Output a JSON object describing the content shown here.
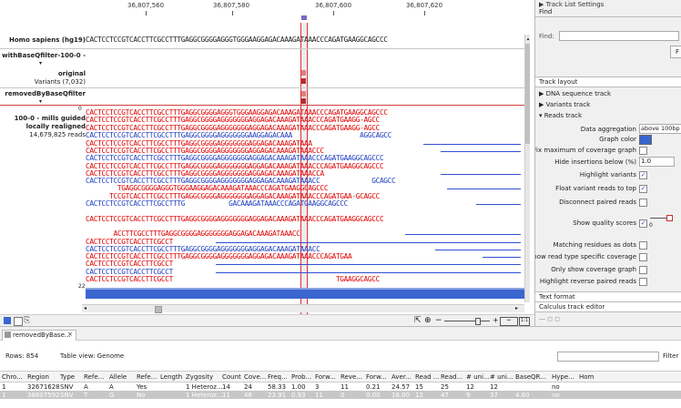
{
  "ruler": [
    "36,807,560",
    "36,807,580",
    "36,807,600",
    "36,807,620"
  ],
  "tracks": {
    "reference": "Homo sapiens (hg19)",
    "withbq": "withBaseQfilter-100-0 -",
    "original_title": "original",
    "original_sub": "Variants (7,032)",
    "removed": "removedByBaseQfilter",
    "mills_1": "100-0 - mills guided",
    "mills_2": "locally realigned",
    "mills_3": "14,679,825 reads",
    "axis_zero": "0",
    "axis_22": "22"
  },
  "reference_seq": "CACTCCTCCGTCACCTTCGCCTTTGAGGCGGGGAGGGTGGGAAGGAGACAAAGATAAACCCAGATGAAGGCAGCCC",
  "consensus_seq": "CACTCCTCCGTCACCTTCGCCTTTGAGGCGGGGAGGGGGGGAGGAGACAAAGATAAACCCAGATGAAGG-AGCC",
  "reads": [
    "CACTCCTCCGTCACCTTCGCCTTTGAGGCGGGGAGGGGGGGAGGAGACAAAGATAAACCCAGATGAAGG-AGCC",
    "CACTCCTCCGTCACCTTCGCCTTTGAGGCGGGGAGGGGGGGAAGGAGACAAA                 AGGCAGCC",
    "CACTCCTCCGTCACCTTCGCCTTTGAGGCGGGGAGGGGGGGAGGAGACAAAGATAAA",
    "CACTCCTCCGTCACCTTCGCCTTTGAGGCGGGGAGGGGGGGAGGAGACAAAGATAAACCC",
    "CACTCCTCCGTCACCTTCGCCTTTGAGGCGGGGAGGGGGGGAGGAGACAAAGATAAACCCAGATGAAGGCAGCCC",
    "CACTCCTCCGTCACCTTCGCCTTTGAGGCGGGGAGGGGGGGAGGAGACAAAGATAAACCCAGATGAAGGCAGCCC",
    "CACTCCTCCGTCACCTTCGCCTTTGAGGCGGGGAGGGGGGGAGGAGACAAAGATAAACCA",
    "CACTCCTCCGTCACCTTCGCCTTTGAGGCGGGGAGGGGGGGAGGAGACAAAGATAAACC             GCAGCC",
    "        TGAGGCGGGGAGGGTGGGAAGGAGACAAAGATAAACCCAGATGAAGGCAGCCC",
    "      TCCGTCACCTTCGCCTTTGAGGCGGGGAGGGGGGGAGGAGACAAAGATAAACCCAGATGAA-GCAGCC",
    "CACTCCTCCGTCACCTTCGCCTTTG           GACAAAGATAAACCCAGATGAAGGCAGCCC",
    "",
    "CACTCCTCCGTCACCTTCGCCTTTGAGGCGGGGAGGGGGGGAGGAGACAAAGATAAACCCAGATGAAGGCAGCCC",
    "",
    "       ACCTTCGCCTTTGAGGCGGGGAGGGGGGGAGGAGACAAAGATAAACC",
    "CACTCCTCCGTCACCTTCGCCT",
    "CACTCCTCCGTCACCTTCGCCTTTGAGGCGGGGAGGGGGGGAGGAGACAAAGATAAACC",
    "CACTCCTCCGTCACCTTCGCCTTTGAGGCGGGGAGGGGGGGAGGAGACAAAGATAAACCCAGATGAA",
    "CACTCCTCCGTCACCTTCGCCT",
    "CACTCCTCCGTCACCTTCGCCT",
    "CACTCCTCCGTCACCTTCGCCT                                         TGAAGGCAGCC"
  ],
  "right_panel": {
    "header": "Track List Settings",
    "find_title": "Find",
    "find_label": "Find:",
    "find_btn": "F",
    "layout_title": "Track layout",
    "dna_section": "DNA sequence track",
    "variants_section": "Variants track",
    "reads_section": "Reads track",
    "data_agg_label": "Data aggregation",
    "data_agg_value": "above 100bp",
    "graph_color": "Graph color",
    "fix_max": "Fix maximum of coverage graph",
    "hide_ins": "Hide insertions below (%)",
    "hide_ins_value": "1.0",
    "highlight_variants": "Highlight variants",
    "float_variant": "Float variant reads to top",
    "disconnect_paired": "Disconnect paired reads",
    "show_quality": "Show quality scores",
    "quality_zero": "0",
    "matching_dots": "Matching residues as dots",
    "show_read_coverage": "Show read type specific coverage",
    "only_coverage": "Only show coverage graph",
    "highlight_reverse": "Highlight reverse paired reads",
    "text_format": "Text format",
    "calculus_editor": "Calculus track editor",
    "colors": {
      "graph": "#3a66d0"
    }
  },
  "tab_label": "removedByBase...",
  "rows_label": "Rows: 854",
  "table_view": "Table view: Genome",
  "filter_btn": "Filter",
  "table": {
    "headers": [
      "Chro...",
      "Region",
      "Type",
      "Refe...",
      "Allele",
      "Refe...",
      "Length",
      "Zygosity",
      "Count",
      "Cove...",
      "Freq...",
      "Prob...",
      "Forw...",
      "Reve...",
      "Forw...",
      "Aver...",
      "Read ...",
      "Read...",
      "# uni...",
      "# uni...",
      "BaseQR...",
      "Hype...",
      "Hom"
    ],
    "rows": [
      [
        "1",
        "32671628",
        "SNV",
        "A",
        "A",
        "Yes",
        "",
        "1 Heteroz...",
        "14",
        "24",
        "58.33",
        "1.00",
        "3",
        "11",
        "0.21",
        "24.57",
        "15",
        "25",
        "12",
        "12",
        "",
        "no",
        ""
      ],
      [
        "1",
        "36807592",
        "SNV",
        "T",
        "G",
        "No",
        "",
        "1 Heteroz...",
        "11",
        "46",
        "23.91",
        "0.93",
        "11",
        "0",
        "0.00",
        "16.00",
        "12",
        "47",
        "9",
        "37",
        "4.80",
        "no",
        ""
      ]
    ]
  }
}
